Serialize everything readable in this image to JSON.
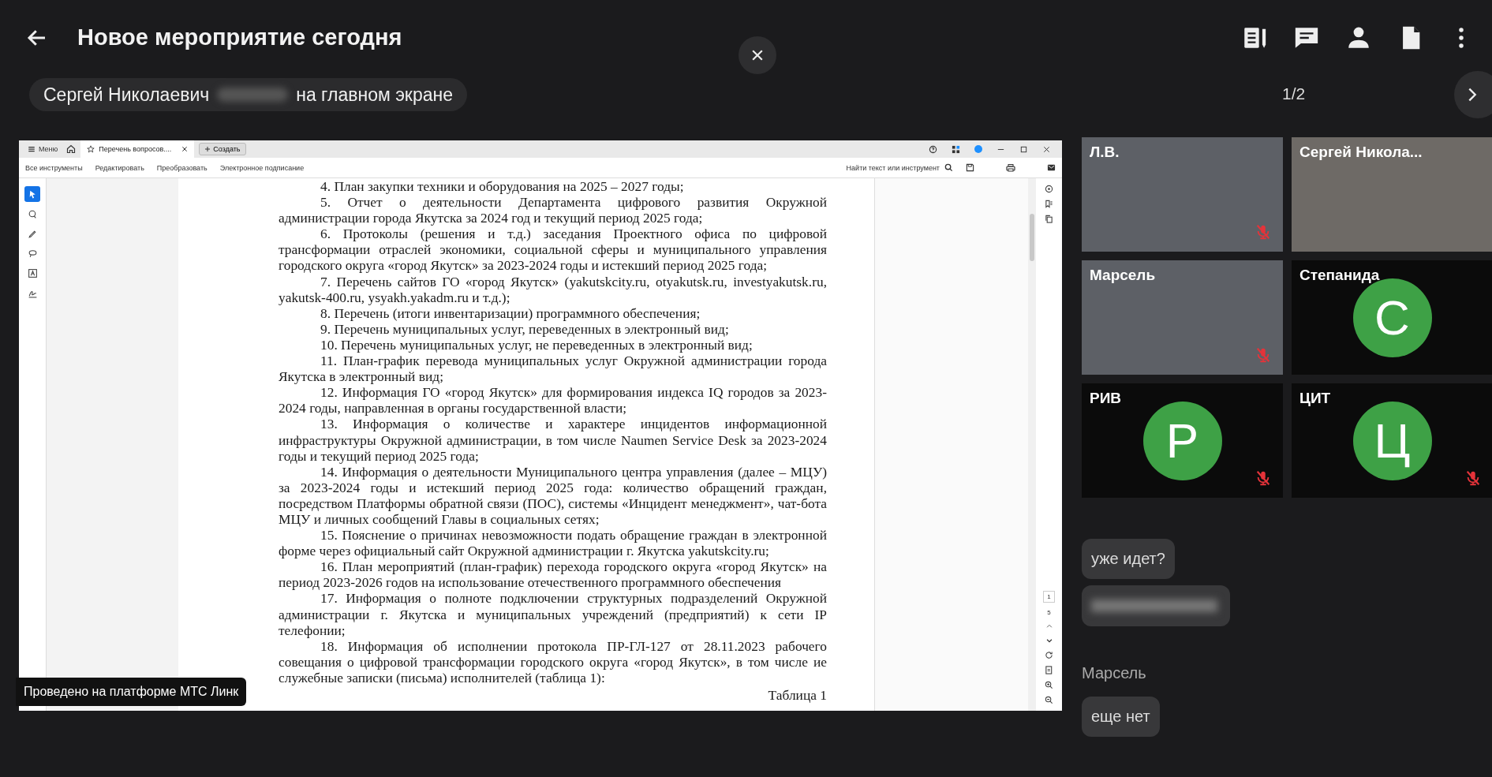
{
  "header": {
    "title": "Новое мероприятие сегодня"
  },
  "presenter": {
    "name": "Сергей Николаевич",
    "suffix": "на главном экране"
  },
  "pager": {
    "label": "1/2"
  },
  "shared_screen": {
    "app": {
      "menu_label": "Меню",
      "tabs": [
        {
          "label": "Перечень вопросов....",
          "selected": true
        }
      ],
      "new_tab": "Создать",
      "menu_items": [
        "Все инструменты",
        "Редактировать",
        "Преобразовать",
        "Электронное подписание"
      ],
      "search": {
        "placeholder": "Найти текст или инструмент"
      },
      "tools": [
        {
          "kind": "select",
          "selected": true
        },
        {
          "kind": "comment",
          "selected": false
        },
        {
          "kind": "pen",
          "selected": false
        },
        {
          "kind": "lasso",
          "selected": false
        },
        {
          "kind": "text",
          "selected": false
        },
        {
          "kind": "sign",
          "selected": false
        }
      ],
      "page_current": "1",
      "page_total": "5"
    },
    "document": {
      "paragraphs": [
        "4. План закупки техники и оборудования на 2025 – 2027 годы;",
        "5. Отчет о деятельности Департамента цифрового развития Окружной администрации города Якутска за 2024 год и текущий период 2025 года;",
        "6. Протоколы (решения и т.д.) заседания Проектного офиса по цифровой трансформации отраслей экономики, социальной сферы и муниципального управления городского округа «город Якутск» за 2023-2024 годы и истекший период 2025 года;",
        "7. Перечень сайтов ГО «город Якутск» (yakutskcity.ru, otyakutsk.ru, investyakutsk.ru, yakutsk-400.ru, ysyakh.yakadm.ru и т.д.);",
        "8. Перечень (итоги инвентаризации) программного обеспечения;",
        "9. Перечень муниципальных услуг, переведенных в электронный вид;",
        "10. Перечень муниципальных услуг, не переведенных в электронный вид;",
        "11. План-график перевода муниципальных услуг Окружной администрации города Якутска в электронный вид;",
        "12. Информация ГО «город Якутск» для формирования индекса IQ городов за 2023-2024 годы, направленная в органы государственной власти;",
        "13. Информация о количестве и характере инцидентов информационной инфраструктуры Окружной администрации, в том числе Naumen Service Desk за 2023-2024 годы и текущий период 2025 года;",
        "14. Информация о деятельности Муниципального центра управления (далее – МЦУ) за 2023-2024 годы и истекший период 2025 года: количество обращений граждан, посредством Платформы обратной связи (ПОС), системы «Инцидент менеджмент», чат-бота МЦУ и личных сообщений Главы в социальных сетях;",
        "15. Пояснение о причинах невозможности подать обращение граждан в электронной форме через официальный сайт Окружной администрации г. Якутска yakutskcity.ru;",
        "16. План мероприятий (план-график) перехода городского округа «город Якутск» на период 2023-2026 годов на использование отечественного программного обеспечения",
        "17. Информация о полноте подключении структурных подразделений Окружной администрации г. Якутска и муниципальных учреждений (предприятий) к сети IP телефонии;",
        "18. Информация об исполнении протокола ПР-ГЛ-127 от 28.11.2023 рабочего совещания о цифровой трансформации городского округа «город Якутск», в том числе ие служебные записки (письма) исполнителей (таблица 1):"
      ],
      "table_caption": "Таблица 1"
    }
  },
  "platform_badge": "Проведено на платформе МТС Линк",
  "participants": [
    {
      "name": "Л.В.",
      "kind": "video",
      "muted": true
    },
    {
      "name": "Сергей Никола...",
      "kind": "video",
      "muted": false
    },
    {
      "name": "Марсель",
      "kind": "video",
      "muted": true
    },
    {
      "name": "Степанида",
      "kind": "avatar",
      "initial": "С",
      "muted": false
    },
    {
      "name": "РИВ",
      "kind": "avatar",
      "initial": "Р",
      "muted": true
    },
    {
      "name": "ЦИТ",
      "kind": "avatar",
      "initial": "Ц",
      "muted": true
    }
  ],
  "chat": {
    "messages": [
      {
        "kind": "bubble",
        "text": "уже идет?"
      },
      {
        "kind": "blurred"
      },
      {
        "kind": "sender",
        "text": "Марсель"
      },
      {
        "kind": "bubble",
        "text": "еще нет"
      }
    ]
  }
}
